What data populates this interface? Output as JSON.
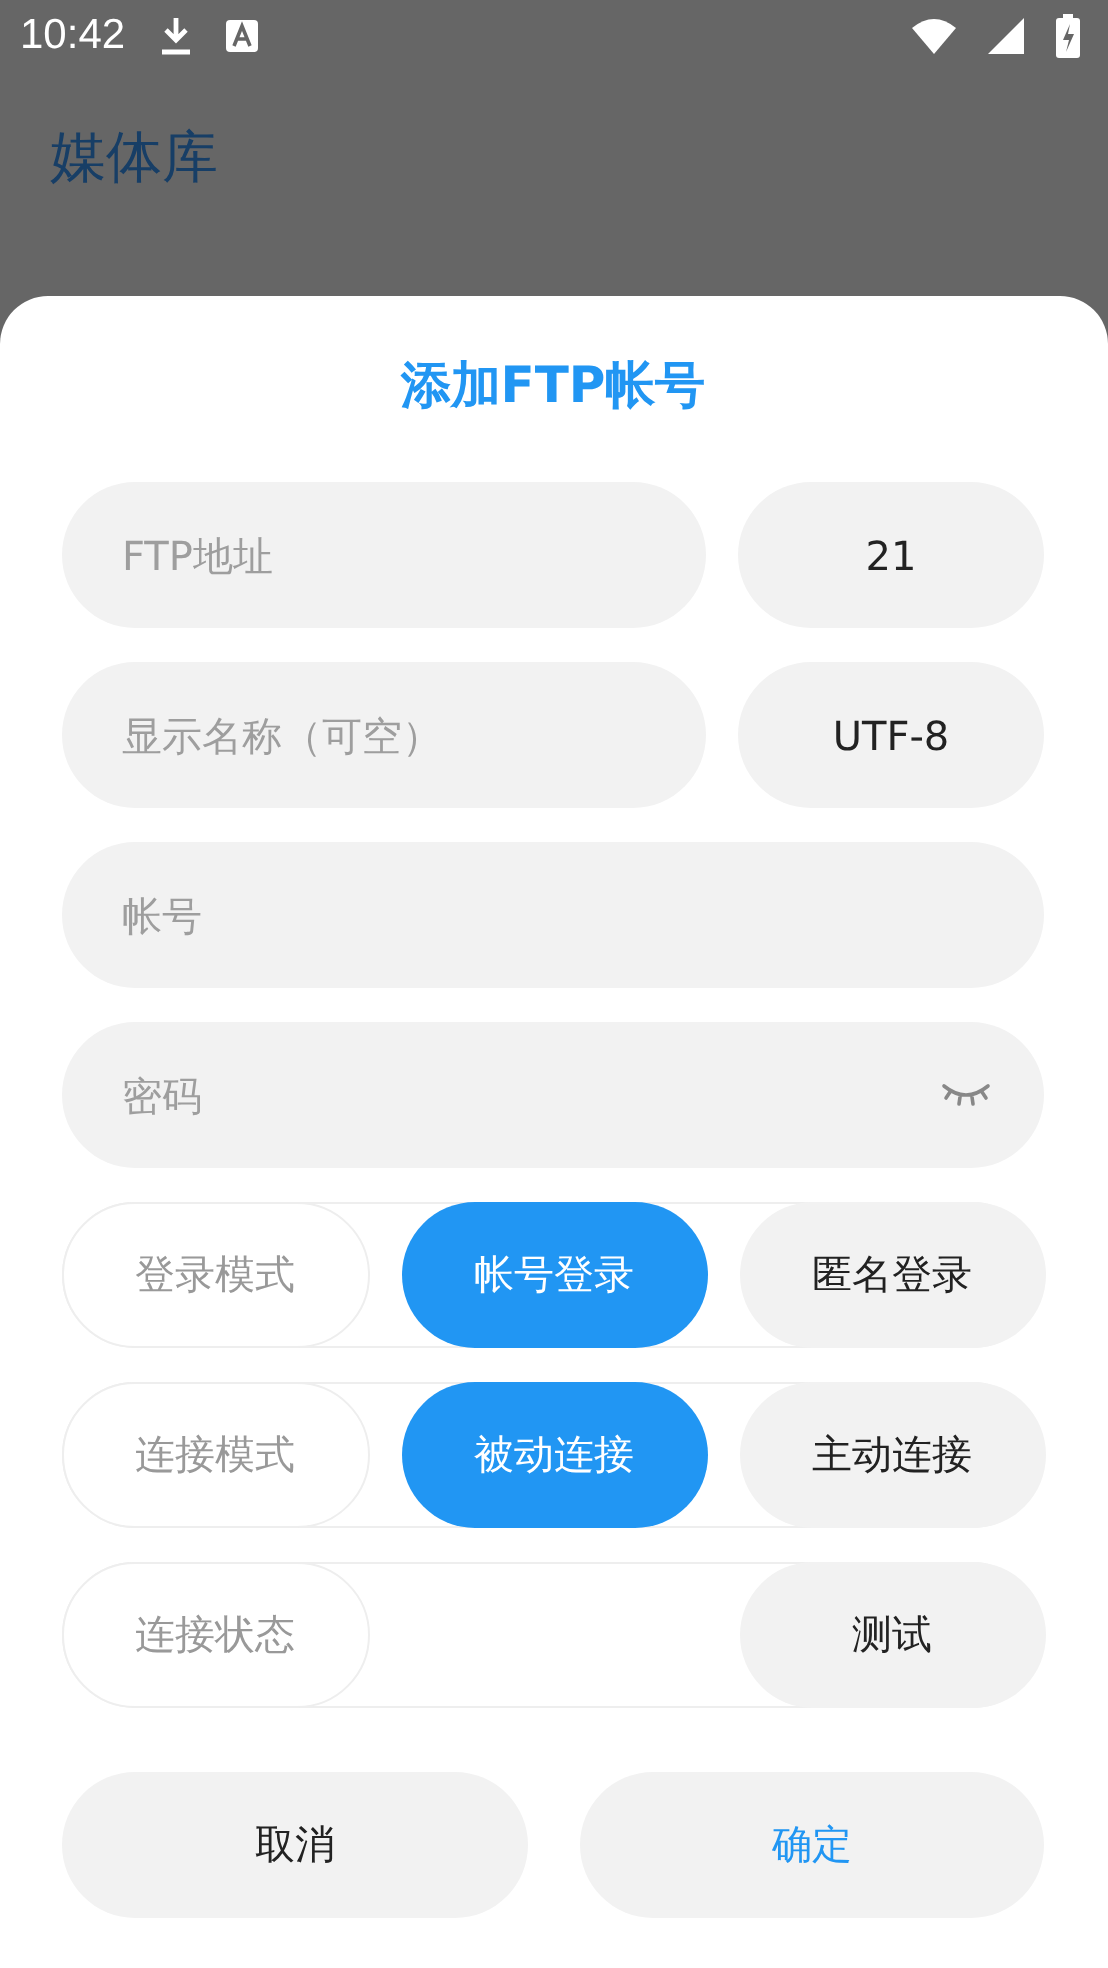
{
  "status_bar": {
    "time": "10:42"
  },
  "background": {
    "title": "媒体库"
  },
  "dialog": {
    "title": "添加FTP帐号",
    "field_rows": [
      [
        {
          "kind": "text",
          "placeholder": "FTP地址"
        },
        {
          "kind": "value",
          "value": "21"
        }
      ],
      [
        {
          "kind": "text",
          "placeholder": "显示名称（可空）"
        },
        {
          "kind": "value",
          "value": "UTF-8"
        }
      ],
      [
        {
          "kind": "text",
          "placeholder": "帐号"
        }
      ],
      [
        {
          "kind": "password",
          "placeholder": "密码"
        }
      ]
    ],
    "option_rows": [
      {
        "kind": "choice",
        "label": "登录模式",
        "options": [
          {
            "label": "帐号登录",
            "selected": true
          },
          {
            "label": "匿名登录",
            "selected": false
          }
        ]
      },
      {
        "kind": "choice",
        "label": "连接模式",
        "options": [
          {
            "label": "被动连接",
            "selected": true
          },
          {
            "label": "主动连接",
            "selected": false
          }
        ]
      },
      {
        "kind": "action",
        "label": "连接状态",
        "button": "测试"
      }
    ],
    "buttons": [
      {
        "kind": "cancel",
        "label": "取消"
      },
      {
        "kind": "confirm",
        "label": "确定"
      }
    ]
  }
}
